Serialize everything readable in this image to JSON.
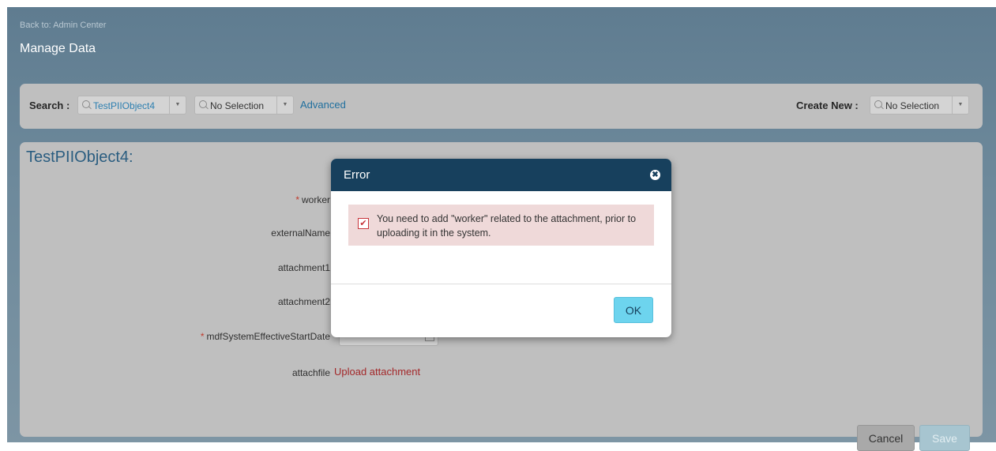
{
  "header": {
    "back_link": "Back to: Admin Center",
    "page_title": "Manage Data"
  },
  "search_bar": {
    "search_label": "Search :",
    "object_select": "TestPIIObject4",
    "record_select": "No Selection",
    "advanced_link": "Advanced",
    "create_new_label": "Create New :",
    "create_new_select": "No Selection"
  },
  "form": {
    "object_title": "TestPIIObject4:",
    "fields": [
      {
        "label": "worker",
        "required": true
      },
      {
        "label": "externalName",
        "required": false
      },
      {
        "label": "attachment1",
        "required": false
      },
      {
        "label": "attachment2",
        "required": false
      },
      {
        "label": "mdfSystemEffectiveStartDate",
        "required": true
      },
      {
        "label": "attachfile",
        "required": false
      }
    ],
    "required_marker": "*",
    "upload_link": "Upload attachment",
    "cancel_label": "Cancel",
    "save_label": "Save"
  },
  "dialog": {
    "title": "Error",
    "close_glyph": "✖",
    "message": "You need to add \"worker\" related to the attachment, prior to uploading it in the system.",
    "check_glyph": "✔",
    "ok_label": "OK"
  },
  "icons": {
    "search": "magnifier-icon",
    "dropdown": "chevron-down-icon",
    "calendar": "calendar-icon",
    "close": "close-icon",
    "checkbox": "checkbox-checked-icon"
  },
  "colors": {
    "header_bg": "#17405d",
    "link_blue": "#1f6f9e",
    "link_red": "#a3282a",
    "ok_button": "#6dd4ee",
    "error_bg": "#efd9d9",
    "required": "#c0392b"
  }
}
